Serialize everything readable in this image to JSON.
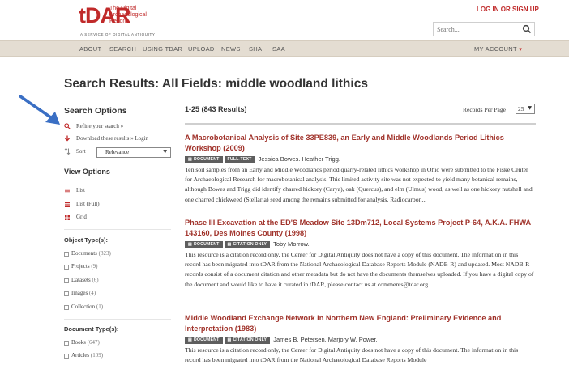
{
  "header": {
    "logo_mark": "tDAR",
    "logo_sub": "The Digital Archaeological Record",
    "logo_tag": "A SERVICE OF DIGITAL ANTIQUITY",
    "login": "LOG IN OR SIGN UP",
    "search_placeholder": "Search..."
  },
  "nav": {
    "items": [
      "ABOUT",
      "SEARCH",
      "USING TDAR",
      "UPLOAD",
      "NEWS",
      "SHA",
      "SAA"
    ],
    "my_account": "MY ACCOUNT"
  },
  "page_title": "Search Results: All Fields: middle woodland lithics",
  "sidebar": {
    "search_options_title": "Search Options",
    "refine": "Refine your search »",
    "download": "Download these results » Login",
    "sort_label": "Sort",
    "sort_value": "Relevance",
    "view_options_title": "View Options",
    "views": [
      "List",
      "List (Full)",
      "Grid"
    ],
    "object_types_title": "Object Type(s):",
    "object_types": [
      {
        "label": "Documents",
        "count": "(823)"
      },
      {
        "label": "Projects",
        "count": "(9)"
      },
      {
        "label": "Datasets",
        "count": "(6)"
      },
      {
        "label": "Images",
        "count": "(4)"
      },
      {
        "label": "Collection",
        "count": "(1)"
      }
    ],
    "document_types_title": "Document Type(s):",
    "document_types": [
      {
        "label": "Books",
        "count": "(647)"
      },
      {
        "label": "Articles",
        "count": "(109)"
      }
    ]
  },
  "results": {
    "count": "1-25 (843 Results)",
    "records_per_page_label": "Records Per Page",
    "records_per_page_value": "25",
    "items": [
      {
        "title": "A Macrobotanical Analysis of Site 33PE839, an Early and Middle Woodlands Period Lithics Workshop (2009)",
        "badges": [
          "DOCUMENT",
          "FULL-TEXT"
        ],
        "authors": "Jessica Bowes.  Heather Trigg.",
        "description": "Ten soil samples from an Early and Middle Woodlands period quarry-related lithics workshop in Ohio were submitted to the Fiske Center for Archaeological Research for macrobotanical analysis. This limited activity site was not expected to yield many botanical remains, although Bowes and Trigg did identify charred hickory (Carya), oak (Quercus), and elm (Ulmus) wood, as well as one hickory nutshell and one charred chickweed (Stellaria) seed among the remains submitted for analysis. Radiocarbon..."
      },
      {
        "title": "Phase III Excavation at the ED'S Meadow Site 13Dm712, Local Systems Project P-64, A.K.A. FHWA 143160, Des Moines County (1998)",
        "badges": [
          "DOCUMENT",
          "CITATION ONLY"
        ],
        "authors": "Toby Morrow.",
        "description": "This resource is a citation record only, the Center for Digital Antiquity does not have a copy of this document. The information in this record has been migrated into tDAR from the National Archaeological Database Reports Module (NADB-R) and updated. Most NADB-R records consist of a document citation and other metadata but do not have the documents themselves uploaded. If you have a digital copy of the document and would like to have it curated in tDAR, please contact us at comments@tdar.org."
      },
      {
        "title": "Middle Woodland Exchange Network in Northern New England: Preliminary Evidence and Interpretation (1983)",
        "badges": [
          "DOCUMENT",
          "CITATION ONLY"
        ],
        "authors": "James B. Petersen.  Marjory W. Power.",
        "description": "This resource is a citation record only, the Center for Digital Antiquity does not have a copy of this document. The information in this record has been migrated into tDAR from the National Archaeological Database Reports Module"
      }
    ]
  },
  "colors": {
    "brand_red": "#c02a2a",
    "title_red": "#a0322a",
    "nav_bg": "#e4ddd2",
    "badge_bg": "#5e5e5e",
    "arrow_blue": "#3a6fc4"
  },
  "icons": {
    "search": "search-icon",
    "refine": "search-icon",
    "download": "download-arrow-icon",
    "sort": "sort-icon",
    "list": "list-icon",
    "list_full": "list-full-icon",
    "grid": "grid-icon",
    "arrow": "annotation-arrow"
  }
}
